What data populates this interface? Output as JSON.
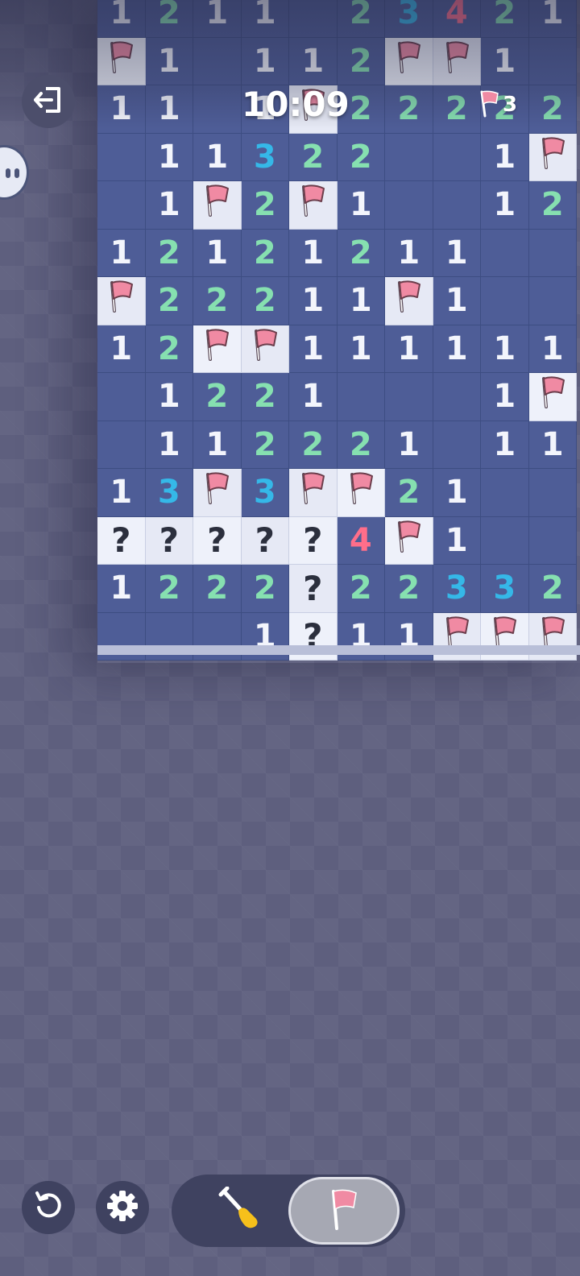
{
  "hud": {
    "timer": "10:09",
    "flags_remaining": "3",
    "exit_icon": "exit-icon",
    "avatar_icon": "robot-face-icon"
  },
  "controls": {
    "restart_icon": "restart-icon",
    "settings_icon": "gear-icon",
    "dig_mode_icon": "shovel-icon",
    "flag_mode_icon": "flag-icon",
    "active_mode": "flag"
  },
  "colors": {
    "n1": "#f3f5fc",
    "n2": "#86e0b0",
    "n3": "#35b8e8",
    "n4": "#ff6e8a",
    "flag": "#f08aa3",
    "revealed": "#4e5d97",
    "hidden": "#e6e9f5"
  },
  "board": {
    "columns": 10,
    "rows_visible": 14,
    "legend": {
      "F": "flag",
      "?": "question",
      ".": "empty",
      "digits": "adjacent mine count"
    },
    "rows": [
      [
        "1",
        "2",
        "1",
        "1",
        ".",
        "2",
        "3",
        "4",
        "2",
        "1"
      ],
      [
        "F",
        "1",
        ".",
        "1",
        "1",
        "2",
        "F",
        "F",
        "1",
        "."
      ],
      [
        "1",
        "1",
        ".",
        "1",
        "F",
        "2",
        "2",
        "2",
        "2",
        "2"
      ],
      [
        ".",
        "1",
        "1",
        "3",
        "2",
        "2",
        ".",
        ".",
        "1",
        "F"
      ],
      [
        ".",
        "1",
        "F",
        "2",
        "F",
        "1",
        ".",
        ".",
        "1",
        "2"
      ],
      [
        "1",
        "2",
        "1",
        "2",
        "1",
        "2",
        "1",
        "1",
        ".",
        "."
      ],
      [
        "F",
        "2",
        "2",
        "2",
        "1",
        "1",
        "F",
        "1",
        ".",
        "."
      ],
      [
        "1",
        "2",
        "F",
        "F",
        "1",
        "1",
        "1",
        "1",
        "1",
        "1"
      ],
      [
        ".",
        "1",
        "2",
        "2",
        "1",
        ".",
        ".",
        ".",
        "1",
        "F"
      ],
      [
        ".",
        "1",
        "1",
        "2",
        "2",
        "2",
        "1",
        ".",
        "1",
        "1"
      ],
      [
        "1",
        "3",
        "F",
        "3",
        "F",
        "F",
        "2",
        "1",
        ".",
        "."
      ],
      [
        "?",
        "?",
        "?",
        "?",
        "?",
        "4",
        "F",
        "1",
        ".",
        "."
      ],
      [
        "1",
        "2",
        "2",
        "2",
        "?",
        "2",
        "2",
        "3",
        "3",
        "2"
      ],
      [
        ".",
        ".",
        ".",
        "1",
        "?",
        "1",
        "1",
        "F",
        "F",
        "F"
      ]
    ]
  }
}
